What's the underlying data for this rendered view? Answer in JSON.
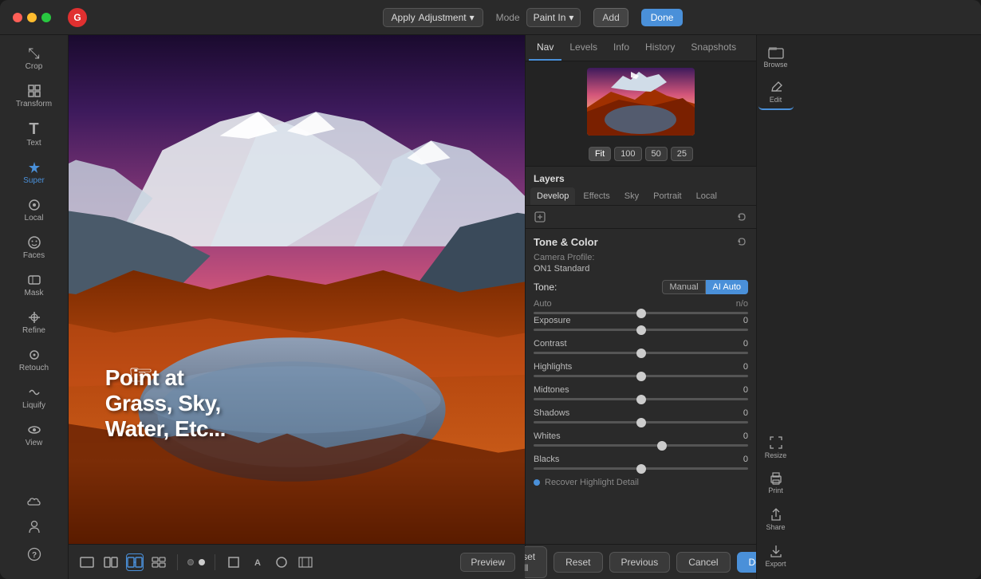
{
  "titlebar": {
    "apply_label": "Apply",
    "adjustment_label": "Adjustment",
    "mode_label": "Mode",
    "paint_in_label": "Paint In",
    "add_label": "Add",
    "done_label": "Done"
  },
  "tools": {
    "left": [
      {
        "id": "crop",
        "icon": "⤡",
        "label": "Crop"
      },
      {
        "id": "transform",
        "icon": "⊞",
        "label": "Transform"
      },
      {
        "id": "text",
        "icon": "T",
        "label": "Text"
      },
      {
        "id": "super",
        "icon": "✦",
        "label": "Super",
        "active": true
      },
      {
        "id": "local",
        "icon": "◎",
        "label": "Local"
      },
      {
        "id": "faces",
        "icon": "☺",
        "label": "Faces"
      },
      {
        "id": "mask",
        "icon": "▭",
        "label": "Mask"
      },
      {
        "id": "refine",
        "icon": "⟳",
        "label": "Refine"
      },
      {
        "id": "retouch",
        "icon": "◉",
        "label": "Retouch"
      },
      {
        "id": "liquify",
        "icon": "~",
        "label": "Liquify"
      },
      {
        "id": "view",
        "icon": "👁",
        "label": "View"
      }
    ],
    "bottom_left": [
      {
        "id": "cloud",
        "icon": "☁",
        "label": ""
      },
      {
        "id": "person",
        "icon": "👤",
        "label": ""
      },
      {
        "id": "help",
        "icon": "?",
        "label": ""
      }
    ]
  },
  "canvas": {
    "overlay_text": "Point at\nGrass, Sky,\nWater, Etc..."
  },
  "bottom_toolbar": {
    "preview_label": "Preview",
    "icons": [
      "⬜",
      "⬚",
      "◫",
      "◫"
    ],
    "dots": [
      "empty",
      "filled"
    ]
  },
  "nav_panel": {
    "tabs": [
      {
        "id": "nav",
        "label": "Nav",
        "active": true
      },
      {
        "id": "levels",
        "label": "Levels"
      },
      {
        "id": "info",
        "label": "Info"
      },
      {
        "id": "history",
        "label": "History"
      },
      {
        "id": "snapshots",
        "label": "Snapshots"
      }
    ],
    "zoom_fit": "Fit",
    "zoom_100": "100",
    "zoom_50": "50",
    "zoom_25": "25"
  },
  "layers": {
    "title": "Layers",
    "tabs": [
      {
        "id": "develop",
        "label": "Develop",
        "active": true
      },
      {
        "id": "effects",
        "label": "Effects"
      },
      {
        "id": "sky",
        "label": "Sky"
      },
      {
        "id": "portrait",
        "label": "Portrait"
      },
      {
        "id": "local",
        "label": "Local"
      }
    ]
  },
  "tone_color": {
    "title": "Tone & Color",
    "camera_profile_label": "Camera Profile:",
    "camera_profile_val": "ON1 Standard",
    "tone_label": "Tone:",
    "tone_manual": "Manual",
    "tone_ai_auto": "AI Auto",
    "auto_label": "Auto",
    "auto_val": "n/o",
    "sliders": [
      {
        "name": "Exposure",
        "value": 0,
        "position": 50
      },
      {
        "name": "Contrast",
        "value": 0,
        "position": 50
      },
      {
        "name": "Highlights",
        "value": 0,
        "position": 50
      },
      {
        "name": "Midtones",
        "value": 0,
        "position": 50
      },
      {
        "name": "Shadows",
        "value": 0,
        "position": 50
      },
      {
        "name": "Whites",
        "value": 0,
        "position": 60
      },
      {
        "name": "Blacks",
        "value": 0,
        "position": 50
      }
    ],
    "recover_label": "Recover Highlight Detail"
  },
  "right_tools": [
    {
      "id": "browse",
      "icon": "⊞",
      "label": "Browse"
    },
    {
      "id": "edit",
      "icon": "✎",
      "label": "Edit"
    }
  ],
  "right_far_tools": [
    {
      "id": "resize",
      "icon": "⤢",
      "label": "Resize"
    },
    {
      "id": "print",
      "icon": "⎙",
      "label": "Print"
    },
    {
      "id": "share",
      "icon": "↑",
      "label": "Share"
    },
    {
      "id": "export",
      "icon": "↗",
      "label": "Export"
    }
  ],
  "bottom_actions": {
    "reset_all": "Reset All",
    "reset": "Reset",
    "previous": "Previous",
    "cancel": "Cancel",
    "done": "Done"
  },
  "colors": {
    "accent": "#4a90d9",
    "active_tool": "#4a90d9",
    "bg_dark": "#252525",
    "bg_medium": "#2a2a2a",
    "border": "#1a1a1a"
  }
}
